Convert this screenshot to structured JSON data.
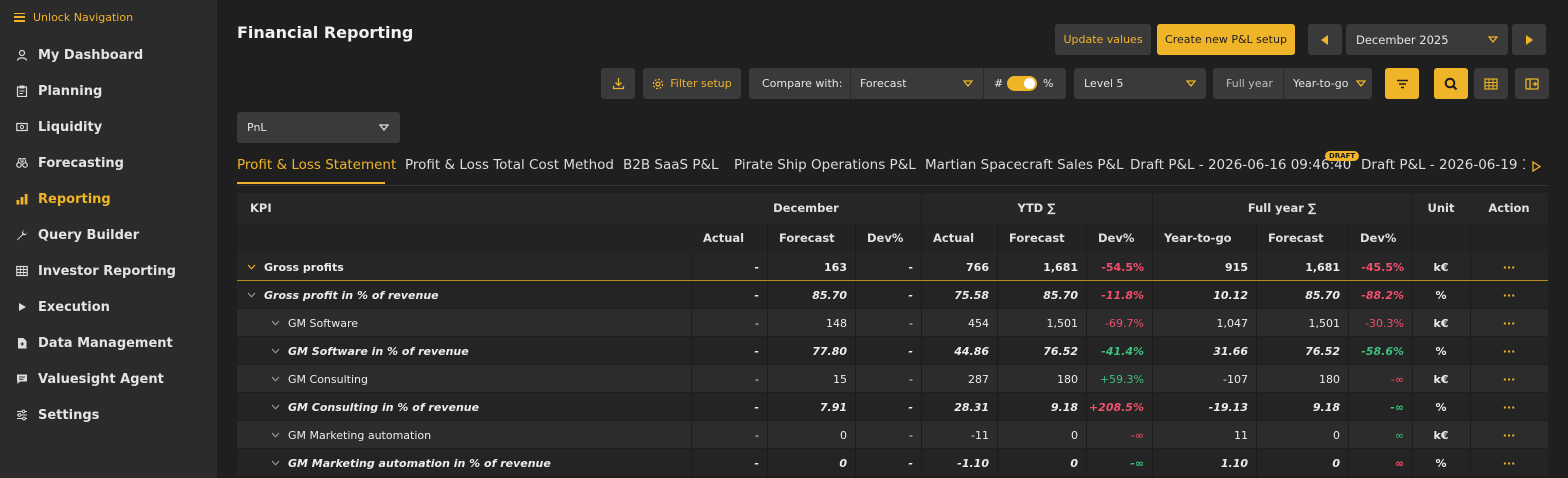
{
  "sidebar": {
    "unlock_label": "Unlock Navigation",
    "items": [
      {
        "label": "My Dashboard",
        "icon": "user-icon",
        "active": false
      },
      {
        "label": "Planning",
        "icon": "clipboard-icon",
        "active": false
      },
      {
        "label": "Liquidity",
        "icon": "cash-icon",
        "active": false
      },
      {
        "label": "Forecasting",
        "icon": "binoculars-icon",
        "active": false
      },
      {
        "label": "Reporting",
        "icon": "bar-chart-icon",
        "active": true
      },
      {
        "label": "Query Builder",
        "icon": "wrench-icon",
        "active": false
      },
      {
        "label": "Investor Reporting",
        "icon": "table-icon",
        "active": false
      },
      {
        "label": "Execution",
        "icon": "play-icon",
        "active": false
      },
      {
        "label": "Data Management",
        "icon": "file-icon",
        "active": false
      },
      {
        "label": "Valuesight Agent",
        "icon": "chat-icon",
        "active": false
      },
      {
        "label": "Settings",
        "icon": "sliders-icon",
        "active": false
      }
    ]
  },
  "header": {
    "title": "Financial Reporting",
    "update_values": "Update values",
    "create_setup": "Create new P&L setup",
    "period": "December 2025"
  },
  "toolbar": {
    "filter_setup": "Filter setup",
    "compare_label": "Compare with:",
    "compare_value": "Forecast",
    "hash": "#",
    "percent": "%",
    "level": "Level 5",
    "full_year": "Full year",
    "year_to_go": "Year-to-go",
    "pnl_select": "PnL"
  },
  "tabs": [
    {
      "label": "Profit & Loss Statement",
      "active": true
    },
    {
      "label": "Profit & Loss Total Cost Method",
      "active": false
    },
    {
      "label": "B2B SaaS P&L",
      "active": false
    },
    {
      "label": "Pirate Ship Operations P&L",
      "active": false
    },
    {
      "label": "Martian Spacecraft Sales P&L",
      "active": false
    },
    {
      "label": "Draft P&L - 2026-06-16 09:46:40",
      "active": false
    },
    {
      "label": "Draft P&L - 2026-06-19 1",
      "active": false
    }
  ],
  "draft_badge": "DRAFT",
  "table": {
    "group_headers": {
      "kpi": "KPI",
      "december": "December",
      "ytd": "YTD ∑",
      "full_year": "Full year ∑",
      "unit": "Unit",
      "action": "Action"
    },
    "sub_headers": [
      "Actual",
      "Forecast",
      "Dev%",
      "Actual",
      "Forecast",
      "Dev%",
      "Year-to-go",
      "Forecast",
      "Dev%"
    ],
    "rows": [
      {
        "kpi": "Gross profits",
        "style": "bold",
        "level": 0,
        "cells": [
          "-",
          "163",
          "-",
          "766",
          "1,681",
          "-54.5%",
          "915",
          "1,681",
          "-45.5%"
        ],
        "unit": "k€",
        "action": "···"
      },
      {
        "kpi": "Gross profit in % of revenue",
        "style": "italic",
        "level": 0,
        "cells": [
          "-",
          "85.70",
          "-",
          "75.58",
          "85.70",
          "-11.8%",
          "10.12",
          "85.70",
          "-88.2%"
        ],
        "unit": "%",
        "action": "···"
      },
      {
        "kpi": "GM Software",
        "style": "normal",
        "level": 1,
        "cells": [
          "-",
          "148",
          "-",
          "454",
          "1,501",
          "-69.7%",
          "1,047",
          "1,501",
          "-30.3%"
        ],
        "unit": "k€",
        "action": "···"
      },
      {
        "kpi": "GM Software in % of revenue",
        "style": "italic",
        "level": 1,
        "cells": [
          "-",
          "77.80",
          "-",
          "44.86",
          "76.52",
          "-41.4%",
          "31.66",
          "76.52",
          "-58.6%"
        ],
        "unit": "%",
        "action": "···"
      },
      {
        "kpi": "GM Consulting",
        "style": "normal",
        "level": 1,
        "cells": [
          "-",
          "15",
          "-",
          "287",
          "180",
          "+59.3%",
          "-107",
          "180",
          "-∞"
        ],
        "unit": "k€",
        "action": "···"
      },
      {
        "kpi": "GM Consulting in % of revenue",
        "style": "italic",
        "level": 1,
        "cells": [
          "-",
          "7.91",
          "-",
          "28.31",
          "9.18",
          "+208.5%",
          "-19.13",
          "9.18",
          "-∞"
        ],
        "unit": "%",
        "action": "···"
      },
      {
        "kpi": "GM Marketing automation",
        "style": "normal",
        "level": 1,
        "cells": [
          "-",
          "0",
          "-",
          "-11",
          "0",
          "-∞",
          "11",
          "0",
          "∞"
        ],
        "unit": "k€",
        "action": "···"
      },
      {
        "kpi": "GM Marketing automation in % of revenue",
        "style": "italic",
        "level": 1,
        "cells": [
          "-",
          "0",
          "-",
          "-1.10",
          "0",
          "-∞",
          "1.10",
          "0",
          "∞"
        ],
        "unit": "%",
        "action": "···"
      }
    ],
    "dev_colors": [
      [
        "neg",
        "neg"
      ],
      [
        "neg",
        "neg"
      ],
      [
        "neg",
        "neg"
      ],
      [
        "pos",
        "pos"
      ],
      [
        "pos",
        "neg"
      ],
      [
        "neg",
        "pos"
      ],
      [
        "neg",
        "pos"
      ],
      [
        "pos",
        "neg"
      ]
    ]
  },
  "colors": {
    "accent": "#f0b429",
    "negative": "#f0506e",
    "positive": "#3fbf7f",
    "sidebar_bg": "#2b2b2b",
    "page_bg": "#1f1f1f"
  }
}
